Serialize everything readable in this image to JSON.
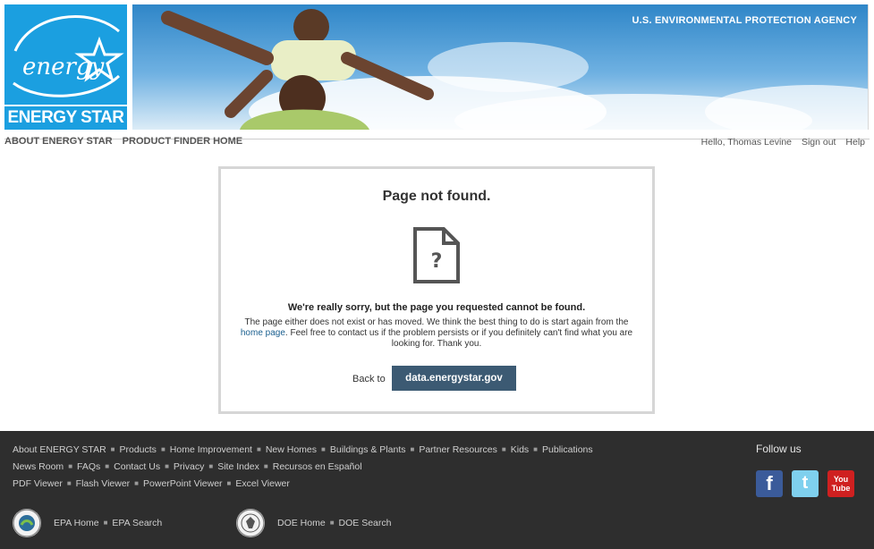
{
  "header": {
    "logo_text": "ENERGY STAR",
    "logo_script": "energy",
    "agency": "U.S. ENVIRONMENTAL PROTECTION AGENCY"
  },
  "main_nav": {
    "about": "ABOUT ENERGY STAR",
    "product_finder": "PRODUCT FINDER HOME"
  },
  "user_nav": {
    "greeting": "Hello, Thomas Levine",
    "sign_out": "Sign out",
    "help": "Help"
  },
  "error_card": {
    "title": "Page not found.",
    "icon": "document-question-icon",
    "apology": "We're really sorry, but the page you requested cannot be found.",
    "desc_part1": "The page either does not exist or has moved. We think the best thing to do is start again from the ",
    "home_link": "home page",
    "desc_part2": ". Feel free to contact us if the problem persists or if you definitely can't find what you are looking for. Thank you.",
    "back_label": "Back to",
    "back_button": "data.energystar.gov"
  },
  "footer": {
    "row1": [
      "About ENERGY STAR",
      "Products",
      "Home Improvement",
      "New Homes",
      "Buildings & Plants",
      "Partner Resources",
      "Kids",
      "Publications"
    ],
    "row2": [
      "News Room",
      "FAQs",
      "Contact Us",
      "Privacy",
      "Site Index",
      "Recursos en Español"
    ],
    "row3": [
      "PDF Viewer",
      "Flash Viewer",
      "PowerPoint Viewer",
      "Excel Viewer"
    ],
    "follow_us": "Follow us",
    "social": [
      {
        "name": "facebook-icon",
        "glyph": "f"
      },
      {
        "name": "twitter-icon",
        "glyph": "t"
      },
      {
        "name": "youtube-icon",
        "glyph": "You\nTube"
      }
    ],
    "epa_home": "EPA Home",
    "epa_search": "EPA Search",
    "doe_home": "DOE Home",
    "doe_search": "DOE Search"
  },
  "colors": {
    "brand_blue": "#1b9fe0",
    "button": "#3c5a73",
    "footer_bg": "#2e2e2e",
    "link": "#1a5f8f"
  }
}
